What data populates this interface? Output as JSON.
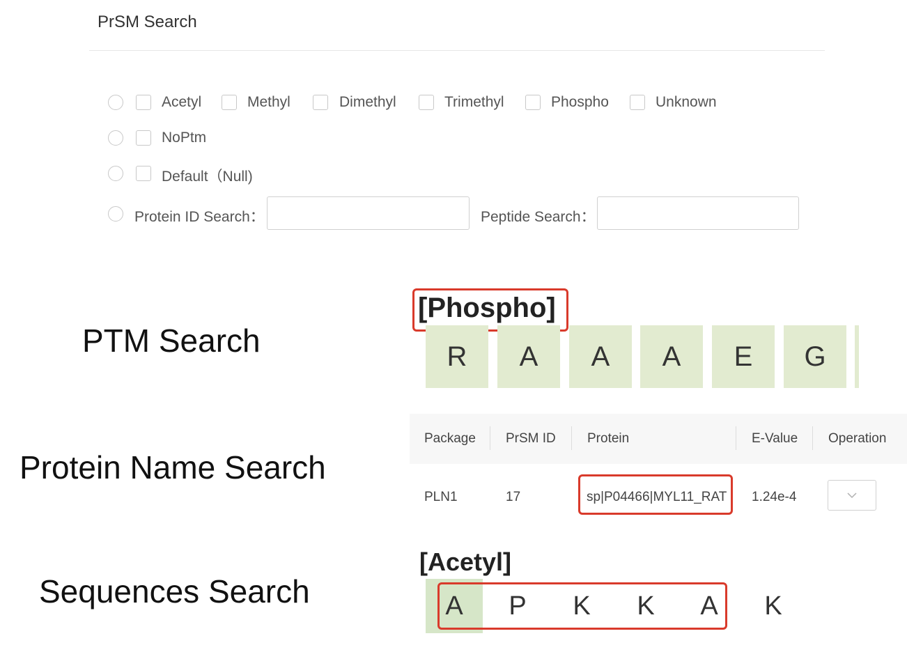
{
  "header": {
    "title": "PrSM Search"
  },
  "ptm_options": {
    "row1": [
      "Acetyl",
      "Methyl",
      "Dimethyl",
      "Trimethyl",
      "Phospho",
      "Unknown"
    ],
    "row2": "NoPtm",
    "row3": "Default（Null)"
  },
  "search": {
    "protein_label": "Protein ID Search：",
    "protein_value": "",
    "peptide_label": "Peptide Search：",
    "peptide_value": ""
  },
  "sections": {
    "ptm": "PTM Search",
    "protein": "Protein Name Search",
    "sequence": "Sequences Search"
  },
  "ptm_example": {
    "tag": "[Phospho]",
    "residues": [
      "R",
      "A",
      "A",
      "A",
      "E",
      "G"
    ]
  },
  "result_table": {
    "headers": [
      "Package",
      "PrSM ID",
      "Protein",
      "E-Value",
      "Operation"
    ],
    "row": {
      "package": "PLN1",
      "prsm_id": "17",
      "protein": "sp|P04466|MYL11_RAT",
      "e_value": "1.24e-4"
    },
    "operation_icon": "chevron-down-icon"
  },
  "sequence_example": {
    "tag": "[Acetyl]",
    "residues": [
      "A",
      "P",
      "K",
      "K",
      "A",
      "K"
    ]
  },
  "colors": {
    "highlight": "#d93a2b",
    "residue_bg": "#e2ebd0"
  }
}
